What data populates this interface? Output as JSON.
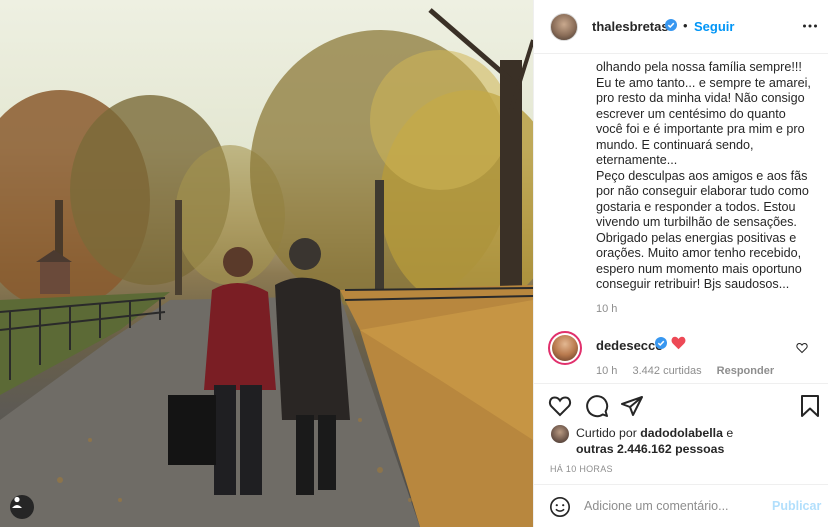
{
  "post": {
    "owner": {
      "username": "thalesbretas",
      "verified": true
    },
    "follow_label": "Seguir",
    "separator": "•",
    "caption_text": "olhando pela nossa família sempre!!!\nEu te amo tanto... e sempre te amarei,\npro resto da minha vida! Não consigo\nescrever um centésimo do quanto\nvocê foi e é importante pra mim e pro\nmundo. E continuará sendo,\neternamente...\nPeço desculpas aos amigos e aos fãs\npor não conseguir elaborar tudo como\ngostaria e responder a todos. Estou\nvivendo um turbilhão de sensações.\nObrigado pelas energias positivas e\norações. Muito amor tenho recebido,\nespero num momento mais oportuno\nconseguir retribuir! Bjs saudosos...",
    "caption_time": "10 h"
  },
  "comment": {
    "username": "dedesecco",
    "verified": true,
    "time": "10 h",
    "likes": "3.442 curtidas",
    "reply_label": "Responder"
  },
  "likes": {
    "prefix": "Curtido por ",
    "user": "dadodolabella",
    "middle": " e",
    "others": "outras 2.446.162 pessoas"
  },
  "post_age": "HÁ 10 HORAS",
  "add_comment": {
    "placeholder": "Adicione um comentário...",
    "publish_label": "Publicar"
  },
  "icons": {
    "like": "heart-outline-icon",
    "comment": "comment-bubble-icon",
    "share": "paper-plane-icon",
    "save": "bookmark-icon",
    "emoji": "smiley-icon",
    "more": "ellipsis-icon",
    "verified": "verified-badge-icon",
    "user_tag": "user-tag-icon"
  },
  "colors": {
    "link_blue": "#0095f6",
    "verified_blue": "#3897f0",
    "heart_red": "#ed4956",
    "text": "#262626",
    "muted": "#8e8e8e"
  }
}
